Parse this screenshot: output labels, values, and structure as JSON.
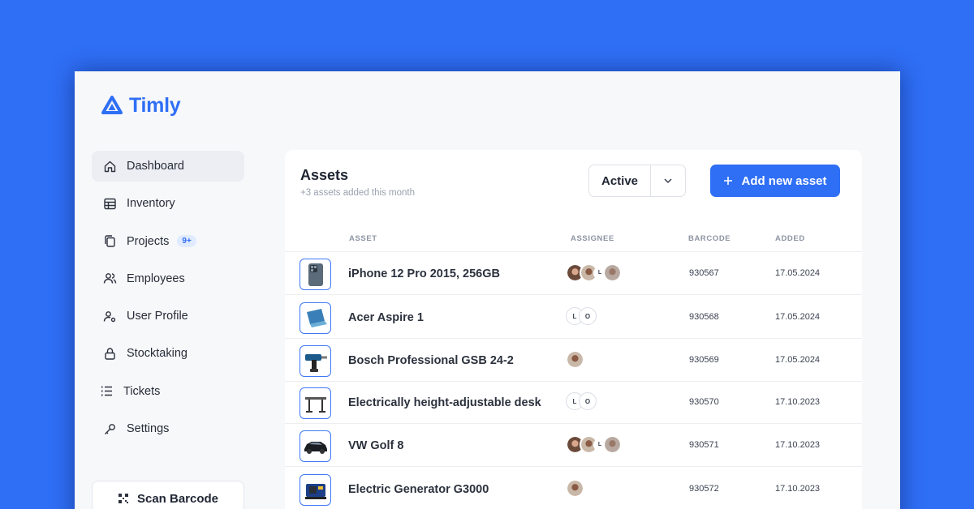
{
  "brand": {
    "name": "Timly",
    "color": "#2f6ff6"
  },
  "nav": {
    "items": [
      {
        "label": "Dashboard",
        "icon": "home-icon",
        "active": true
      },
      {
        "label": "Inventory",
        "icon": "table-icon"
      },
      {
        "label": "Projects",
        "icon": "copy-icon",
        "badge": "9+"
      },
      {
        "label": "Employees",
        "icon": "users-icon"
      },
      {
        "label": "User Profile",
        "icon": "user-cog-icon"
      },
      {
        "label": "Stocktaking",
        "icon": "lock-icon"
      },
      {
        "label": "Tickets",
        "icon": "list-icon"
      },
      {
        "label": "Settings",
        "icon": "key-icon"
      }
    ],
    "scan_label": "Scan Barcode"
  },
  "assets": {
    "title": "Assets",
    "subtitle": "+3 assets added this month",
    "filter_value": "Active",
    "add_label": "Add new asset",
    "columns": {
      "asset": "ASSET",
      "assignee": "ASSIGNEE",
      "barcode": "BARCODE",
      "added": "ADDED"
    },
    "rows": [
      {
        "name": "iPhone 12 Pro 2015, 256GB",
        "barcode": "930567",
        "added": "17.05.2024",
        "image": "phone-icon",
        "assignee_letters": [
          "L"
        ]
      },
      {
        "name": "Acer Aspire 1",
        "barcode": "930568",
        "added": "17.05.2024",
        "image": "laptop-icon",
        "assignee_letters": [
          "L",
          "O"
        ]
      },
      {
        "name": "Bosch Professional GSB 24-2",
        "barcode": "930569",
        "added": "17.05.2024",
        "image": "drill-icon",
        "assignee_letters": []
      },
      {
        "name": "Electrically height-adjustable desk",
        "barcode": "930570",
        "added": "17.10.2023",
        "image": "desk-icon",
        "assignee_letters": [
          "L",
          "O"
        ]
      },
      {
        "name": "VW Golf 8",
        "barcode": "930571",
        "added": "17.10.2023",
        "image": "car-icon",
        "assignee_letters": [
          "L"
        ]
      },
      {
        "name": "Electric Generator G3000",
        "barcode": "930572",
        "added": "17.10.2023",
        "image": "generator-icon",
        "assignee_letters": []
      }
    ]
  }
}
